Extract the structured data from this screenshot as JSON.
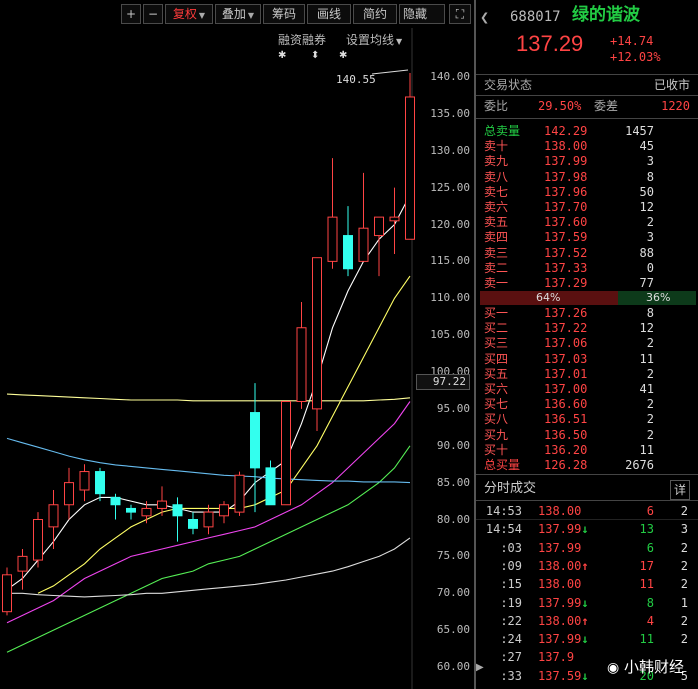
{
  "toolbar": {
    "plus": "+",
    "minus": "−",
    "fuquan": "复权",
    "diejia": "叠加",
    "chouma": "筹码",
    "huaxian": "画线",
    "jianyue": "简约",
    "yincang": "隐藏",
    "fullscreen": "⛶"
  },
  "chart_links": {
    "margin": "融资融券",
    "ma_setting": "设置均线"
  },
  "chart_data": {
    "type": "candlestick",
    "y_ticks": [
      "140.00",
      "135.00",
      "130.00",
      "125.00",
      "120.00",
      "115.00",
      "110.00",
      "105.00",
      "100.00",
      "95.00",
      "90.00",
      "85.00",
      "80.00",
      "75.00",
      "70.00",
      "65.00",
      "60.00"
    ],
    "ylim": [
      60,
      140
    ],
    "max_label": "140.55",
    "current_price_label": "97.22",
    "candles": [
      {
        "o": 67.5,
        "h": 73.5,
        "l": 67.0,
        "c": 72.5
      },
      {
        "o": 73.0,
        "h": 76.0,
        "l": 70.5,
        "c": 75.0
      },
      {
        "o": 74.5,
        "h": 81.0,
        "l": 73.5,
        "c": 80.0
      },
      {
        "o": 79.0,
        "h": 84.0,
        "l": 76.0,
        "c": 82.0
      },
      {
        "o": 82.0,
        "h": 87.0,
        "l": 80.0,
        "c": 85.0
      },
      {
        "o": 84.0,
        "h": 87.5,
        "l": 82.5,
        "c": 86.5
      },
      {
        "o": 86.5,
        "h": 87.0,
        "l": 82.5,
        "c": 83.5
      },
      {
        "o": 83.0,
        "h": 83.5,
        "l": 80.0,
        "c": 82.0
      },
      {
        "o": 81.5,
        "h": 82.0,
        "l": 80.0,
        "c": 81.0
      },
      {
        "o": 80.5,
        "h": 82.5,
        "l": 79.5,
        "c": 81.5
      },
      {
        "o": 81.5,
        "h": 84.5,
        "l": 80.5,
        "c": 82.5
      },
      {
        "o": 82.0,
        "h": 83.0,
        "l": 77.0,
        "c": 80.5
      },
      {
        "o": 80.0,
        "h": 81.0,
        "l": 78.0,
        "c": 78.8
      },
      {
        "o": 79.0,
        "h": 82.0,
        "l": 78.0,
        "c": 81.0
      },
      {
        "o": 80.5,
        "h": 82.5,
        "l": 79.5,
        "c": 82.0
      },
      {
        "o": 81.0,
        "h": 86.5,
        "l": 80.5,
        "c": 86.0
      },
      {
        "o": 94.5,
        "h": 98.5,
        "l": 81.0,
        "c": 87.0
      },
      {
        "o": 87.0,
        "h": 88.0,
        "l": 82.0,
        "c": 82.0
      },
      {
        "o": 82.0,
        "h": 96.0,
        "l": 82.0,
        "c": 96.0
      },
      {
        "o": 96.0,
        "h": 109.5,
        "l": 95.0,
        "c": 106.0
      },
      {
        "o": 95.0,
        "h": 115.0,
        "l": 92.0,
        "c": 115.5
      },
      {
        "o": 115.0,
        "h": 129.0,
        "l": 114.0,
        "c": 121.0
      },
      {
        "o": 118.5,
        "h": 122.5,
        "l": 113.0,
        "c": 114.0
      },
      {
        "o": 115.0,
        "h": 127.0,
        "l": 115.0,
        "c": 119.5
      },
      {
        "o": 118.5,
        "h": 121.0,
        "l": 113.0,
        "c": 121.0
      },
      {
        "o": 120.5,
        "h": 125.0,
        "l": 116.0,
        "c": 121.0
      },
      {
        "o": 118.0,
        "h": 140.55,
        "l": 118.0,
        "c": 137.29
      }
    ],
    "ma_lines": [
      {
        "name": "MA5",
        "color": "#ffffff",
        "values": [
          70.5,
          72,
          74.5,
          77,
          80,
          82,
          83,
          83,
          82.5,
          82,
          82,
          81.5,
          81,
          81,
          81,
          82.5,
          85,
          86.5,
          88,
          93,
          99,
          106,
          111,
          115,
          118,
          120,
          124
        ]
      },
      {
        "name": "MA10",
        "color": "#ffff66",
        "values": [
          null,
          null,
          70,
          71,
          72.5,
          74,
          76,
          77.5,
          79,
          80,
          81,
          81.5,
          81.5,
          81.5,
          81.5,
          81.5,
          82,
          83,
          84,
          87,
          90,
          94,
          98,
          102,
          106,
          110,
          113
        ]
      },
      {
        "name": "MA20",
        "color": "#ee44ee",
        "values": [
          66,
          67,
          68,
          69,
          70.5,
          72,
          73,
          74,
          75,
          75.5,
          76,
          76.5,
          77,
          77.5,
          78,
          78.5,
          79,
          80,
          81,
          82,
          83.5,
          85,
          87,
          89,
          91,
          93,
          96
        ]
      },
      {
        "name": "MA30",
        "color": "#55ee55",
        "values": [
          62,
          63,
          64,
          65,
          66,
          67,
          68,
          69,
          70,
          71,
          72,
          72.5,
          73,
          74,
          74.5,
          75,
          76,
          77,
          78,
          79,
          80,
          81,
          82,
          83.5,
          85,
          87,
          90
        ]
      },
      {
        "name": "MA60",
        "color": "#dddddd",
        "values": [
          70,
          70,
          69.8,
          69.7,
          69.6,
          69.5,
          69.6,
          69.7,
          69.8,
          70,
          70,
          70.2,
          70.4,
          70.6,
          70.8,
          71,
          71.2,
          71.5,
          71.8,
          72.2,
          72.6,
          73,
          73.6,
          74.3,
          75,
          76,
          77.5
        ]
      },
      {
        "name": "MA120",
        "color": "#ffff99",
        "values": [
          97,
          96.9,
          96.8,
          96.7,
          96.6,
          96.5,
          96.4,
          96.3,
          96.2,
          96.2,
          96.2,
          96.2,
          96.1,
          96.1,
          96.1,
          96.1,
          96.1,
          96.1,
          96.1,
          96.1,
          96.1,
          96.1,
          96.1,
          96.1,
          96.2,
          96.3,
          96.5
        ]
      },
      {
        "name": "MA250",
        "color": "#66bbee",
        "values": [
          91,
          90.4,
          89.8,
          89.2,
          88.6,
          88.1,
          87.7,
          87.4,
          87.2,
          87,
          86.8,
          86.6,
          86.4,
          86.2,
          86,
          85.9,
          85.8,
          85.6,
          85.5,
          85.4,
          85.3,
          85.2,
          85.2,
          85.1,
          85.1,
          85.1,
          85
        ]
      }
    ]
  },
  "quote": {
    "code": "688017",
    "name": "绿的谐波",
    "price": "137.29",
    "change": "+14.74",
    "change_pct": "+12.03%",
    "status_label": "交易状态",
    "status_value": "已收市",
    "weibi_label": "委比",
    "weibi_value": "29.50%",
    "weicha_label": "委差",
    "weicha_value": "1220"
  },
  "sell_orders": [
    {
      "label": "总卖量",
      "price": "142.29",
      "vol": "1457"
    },
    {
      "label": "卖十",
      "price": "138.00",
      "vol": "45"
    },
    {
      "label": "卖九",
      "price": "137.99",
      "vol": "3"
    },
    {
      "label": "卖八",
      "price": "137.98",
      "vol": "8"
    },
    {
      "label": "卖七",
      "price": "137.96",
      "vol": "50"
    },
    {
      "label": "卖六",
      "price": "137.70",
      "vol": "12"
    },
    {
      "label": "卖五",
      "price": "137.60",
      "vol": "2"
    },
    {
      "label": "卖四",
      "price": "137.59",
      "vol": "3"
    },
    {
      "label": "卖三",
      "price": "137.52",
      "vol": "88"
    },
    {
      "label": "卖二",
      "price": "137.33",
      "vol": "0"
    },
    {
      "label": "卖一",
      "price": "137.29",
      "vol": "77"
    }
  ],
  "ratio": {
    "sell_pct": "64%",
    "buy_pct": "36%",
    "sell_frac": 0.64
  },
  "buy_orders": [
    {
      "label": "买一",
      "price": "137.26",
      "vol": "8"
    },
    {
      "label": "买二",
      "price": "137.22",
      "vol": "12"
    },
    {
      "label": "买三",
      "price": "137.06",
      "vol": "2"
    },
    {
      "label": "买四",
      "price": "137.03",
      "vol": "11"
    },
    {
      "label": "买五",
      "price": "137.01",
      "vol": "2"
    },
    {
      "label": "买六",
      "price": "137.00",
      "vol": "41"
    },
    {
      "label": "买七",
      "price": "136.60",
      "vol": "2"
    },
    {
      "label": "买八",
      "price": "136.51",
      "vol": "2"
    },
    {
      "label": "买九",
      "price": "136.50",
      "vol": "2"
    },
    {
      "label": "买十",
      "price": "136.20",
      "vol": "11"
    },
    {
      "label": "总买量",
      "price": "126.28",
      "vol": "2676"
    }
  ],
  "ticks_header": {
    "title": "分时成交",
    "detail": "详"
  },
  "ticks": [
    {
      "time": "14:53",
      "price": "138.00",
      "arrow": "",
      "vol": "6",
      "vol_color": "red",
      "cnt": "2"
    },
    {
      "time": "14:54",
      "price": "137.99",
      "arrow": "↓",
      "vol": "13",
      "vol_color": "green",
      "cnt": "3"
    },
    {
      "time": ":03",
      "price": "137.99",
      "arrow": "",
      "vol": "6",
      "vol_color": "green",
      "cnt": "2"
    },
    {
      "time": ":09",
      "price": "138.00",
      "arrow": "↑",
      "vol": "17",
      "vol_color": "red",
      "cnt": "2"
    },
    {
      "time": ":15",
      "price": "138.00",
      "arrow": "",
      "vol": "11",
      "vol_color": "red",
      "cnt": "2"
    },
    {
      "time": ":19",
      "price": "137.99",
      "arrow": "↓",
      "vol": "8",
      "vol_color": "green",
      "cnt": "1"
    },
    {
      "time": ":22",
      "price": "138.00",
      "arrow": "↑",
      "vol": "4",
      "vol_color": "red",
      "cnt": "2"
    },
    {
      "time": ":24",
      "price": "137.99",
      "arrow": "↓",
      "vol": "11",
      "vol_color": "green",
      "cnt": "2"
    },
    {
      "time": ":27",
      "price": "137.9",
      "arrow": "",
      "vol": "",
      "vol_color": "red",
      "cnt": ""
    },
    {
      "time": ":33",
      "price": "137.59",
      "arrow": "↓",
      "vol": "20",
      "vol_color": "green",
      "cnt": "5"
    }
  ],
  "watermark": "小韩财经"
}
